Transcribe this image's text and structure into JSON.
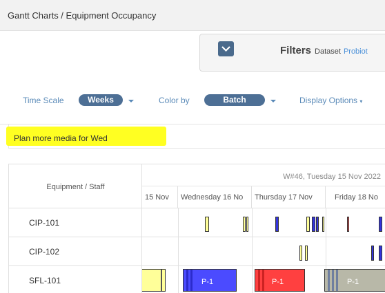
{
  "breadcrumb": "Gantt Charts / Equipment Occupancy",
  "filters": {
    "title": "Filters",
    "dataset_label": "Dataset",
    "dataset_value": "Probiot"
  },
  "toolbar": {
    "time_scale_label": "Time Scale",
    "time_scale_value": "Weeks",
    "color_by_label": "Color by",
    "color_by_value": "Batch",
    "display_options_label": "Display Options"
  },
  "note": {
    "text": "Plan more media for Wed",
    "highlight_color": "#ffff22"
  },
  "gantt": {
    "header_label": "Equipment / Staff",
    "week_label": "W#46, Tuesday 15 Nov 2022",
    "days": [
      "15 Nov",
      "Wednesday 16 No",
      "Thursday 17 Nov",
      "Friday 18 No"
    ],
    "rows": [
      {
        "name": "CIP-101"
      },
      {
        "name": "CIP-102"
      },
      {
        "name": "SFL-101",
        "bars": [
          {
            "label": "",
            "color": "#ffff99"
          },
          {
            "label": "P-1",
            "color": "#4b4bff"
          },
          {
            "label": "P-1",
            "color": "#ff4040"
          },
          {
            "label": "P-1",
            "color": "#b8b8a8"
          }
        ]
      }
    ]
  },
  "colors": {
    "accent": "#4d6f95",
    "link": "#5a8ab8",
    "tick_yellow": "#ffff99",
    "tick_blue": "#3333dd",
    "tick_red": "#ff5555"
  }
}
